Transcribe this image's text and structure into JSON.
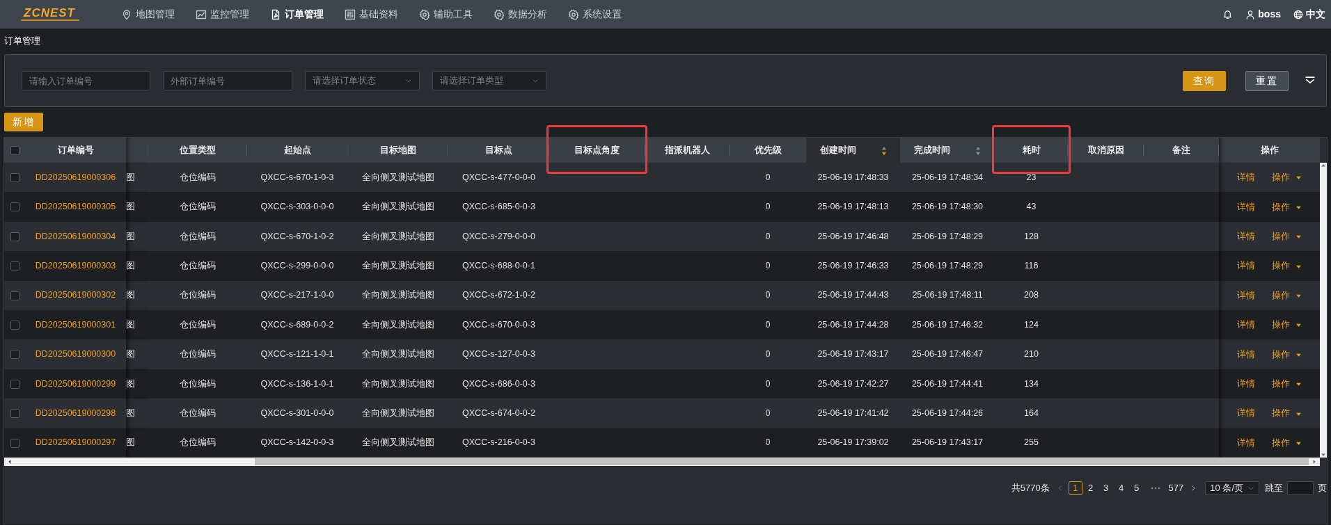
{
  "nav": {
    "logo": "ZCNEST",
    "items": [
      {
        "label": "地图管理",
        "selected": false
      },
      {
        "label": "监控管理",
        "selected": false
      },
      {
        "label": "订单管理",
        "selected": true
      },
      {
        "label": "基础资料",
        "selected": false
      },
      {
        "label": "辅助工具",
        "selected": false
      },
      {
        "label": "数据分析",
        "selected": false
      },
      {
        "label": "系统设置",
        "selected": false
      }
    ],
    "user": "boss",
    "language": "中文"
  },
  "breadcrumb": "订单管理",
  "filters": {
    "fields": [
      {
        "kind": "input",
        "placeholder": "请输入订单编号"
      },
      {
        "kind": "input",
        "placeholder": "外部订单编号"
      },
      {
        "kind": "select",
        "placeholder": "请选择订单状态"
      },
      {
        "kind": "select",
        "placeholder": "请选择订单类型"
      }
    ],
    "buttons": [
      {
        "kind": "primary",
        "label": "查询"
      },
      {
        "kind": "secondary",
        "label": "重置"
      }
    ]
  },
  "add_button": "新增",
  "table": {
    "all_selected": false,
    "columns": [
      {
        "label": "订单编号"
      },
      {
        "label": "位置类型"
      },
      {
        "label": "起始点"
      },
      {
        "label": "目标地图"
      },
      {
        "label": "目标点"
      },
      {
        "label": "目标点角度",
        "highlighted": true
      },
      {
        "label": "指派机器人"
      },
      {
        "label": "优先级"
      },
      {
        "label": "创建时间",
        "sorted": true
      },
      {
        "label": "完成时间",
        "sorted": false
      },
      {
        "label": "耗时",
        "highlighted": true
      },
      {
        "label": "取消原因"
      },
      {
        "label": "备注"
      },
      {
        "label": "操作"
      }
    ],
    "rows": [
      {
        "selected": false,
        "order_no": "DD20250619000306",
        "column_3": "图",
        "location_type": "仓位编码",
        "start": "QXCC-s-670-1-0-3",
        "target_map": "全向侧叉测试地图",
        "target": "QXCC-s-477-0-0-0",
        "priority": "0",
        "created": "25-06-19 17:48:33",
        "finished": "25-06-19 17:48:34",
        "duration": "23",
        "actions": [
          "详情",
          "操作"
        ]
      },
      {
        "selected": false,
        "order_no": "DD20250619000305",
        "column_3": "图",
        "location_type": "仓位编码",
        "start": "QXCC-s-303-0-0-0",
        "target_map": "全向侧叉测试地图",
        "target": "QXCC-s-685-0-0-3",
        "priority": "0",
        "created": "25-06-19 17:48:13",
        "finished": "25-06-19 17:48:30",
        "duration": "43",
        "actions": [
          "详情",
          "操作"
        ]
      },
      {
        "selected": false,
        "order_no": "DD20250619000304",
        "column_3": "图",
        "location_type": "仓位编码",
        "start": "QXCC-s-670-1-0-2",
        "target_map": "全向侧叉测试地图",
        "target": "QXCC-s-279-0-0-0",
        "priority": "0",
        "created": "25-06-19 17:46:48",
        "finished": "25-06-19 17:48:29",
        "duration": "128",
        "actions": [
          "详情",
          "操作"
        ]
      },
      {
        "selected": false,
        "order_no": "DD20250619000303",
        "column_3": "图",
        "location_type": "仓位编码",
        "start": "QXCC-s-299-0-0-0",
        "target_map": "全向侧叉测试地图",
        "target": "QXCC-s-688-0-0-1",
        "priority": "0",
        "created": "25-06-19 17:46:33",
        "finished": "25-06-19 17:48:29",
        "duration": "116",
        "actions": [
          "详情",
          "操作"
        ]
      },
      {
        "selected": false,
        "order_no": "DD20250619000302",
        "column_3": "图",
        "location_type": "仓位编码",
        "start": "QXCC-s-217-1-0-0",
        "target_map": "全向侧叉测试地图",
        "target": "QXCC-s-672-1-0-2",
        "priority": "0",
        "created": "25-06-19 17:44:43",
        "finished": "25-06-19 17:48:11",
        "duration": "208",
        "actions": [
          "详情",
          "操作"
        ]
      },
      {
        "selected": false,
        "order_no": "DD20250619000301",
        "column_3": "图",
        "location_type": "仓位编码",
        "start": "QXCC-s-689-0-0-2",
        "target_map": "全向侧叉测试地图",
        "target": "QXCC-s-670-0-0-3",
        "priority": "0",
        "created": "25-06-19 17:44:28",
        "finished": "25-06-19 17:46:32",
        "duration": "124",
        "actions": [
          "详情",
          "操作"
        ]
      },
      {
        "selected": false,
        "order_no": "DD20250619000300",
        "column_3": "图",
        "location_type": "仓位编码",
        "start": "QXCC-s-121-1-0-1",
        "target_map": "全向侧叉测试地图",
        "target": "QXCC-s-127-0-0-3",
        "priority": "0",
        "created": "25-06-19 17:43:17",
        "finished": "25-06-19 17:46:47",
        "duration": "210",
        "actions": [
          "详情",
          "操作"
        ]
      },
      {
        "selected": false,
        "order_no": "DD20250619000299",
        "column_3": "图",
        "location_type": "仓位编码",
        "start": "QXCC-s-136-1-0-1",
        "target_map": "全向侧叉测试地图",
        "target": "QXCC-s-686-0-0-3",
        "priority": "0",
        "created": "25-06-19 17:42:27",
        "finished": "25-06-19 17:44:41",
        "duration": "134",
        "actions": [
          "详情",
          "操作"
        ]
      },
      {
        "selected": false,
        "order_no": "DD20250619000298",
        "column_3": "图",
        "location_type": "仓位编码",
        "start": "QXCC-s-301-0-0-0",
        "target_map": "全向侧叉测试地图",
        "target": "QXCC-s-674-0-0-2",
        "priority": "0",
        "created": "25-06-19 17:41:42",
        "finished": "25-06-19 17:44:26",
        "duration": "164",
        "actions": [
          "详情",
          "操作"
        ]
      },
      {
        "selected": false,
        "order_no": "DD20250619000297",
        "column_3": "图",
        "location_type": "仓位编码",
        "start": "QXCC-s-142-0-0-3",
        "target_map": "全向侧叉测试地图",
        "target": "QXCC-s-216-0-0-3",
        "priority": "0",
        "created": "25-06-19 17:39:02",
        "finished": "25-06-19 17:43:17",
        "duration": "255",
        "actions": [
          "详情",
          "操作"
        ]
      }
    ]
  },
  "pagination": {
    "total": "共5770条",
    "pages": [
      {
        "kind": "page",
        "label": "1",
        "selected": true
      },
      {
        "kind": "page",
        "label": "2",
        "selected": false
      },
      {
        "kind": "page",
        "label": "3",
        "selected": false
      },
      {
        "kind": "page",
        "label": "4",
        "selected": false
      },
      {
        "kind": "page",
        "label": "5",
        "selected": false
      },
      {
        "kind": "ellipsis"
      },
      {
        "kind": "page",
        "label": "577",
        "selected": false
      }
    ],
    "page_size": "10 条/页",
    "jump_label": "跳至",
    "page_unit": "页"
  }
}
